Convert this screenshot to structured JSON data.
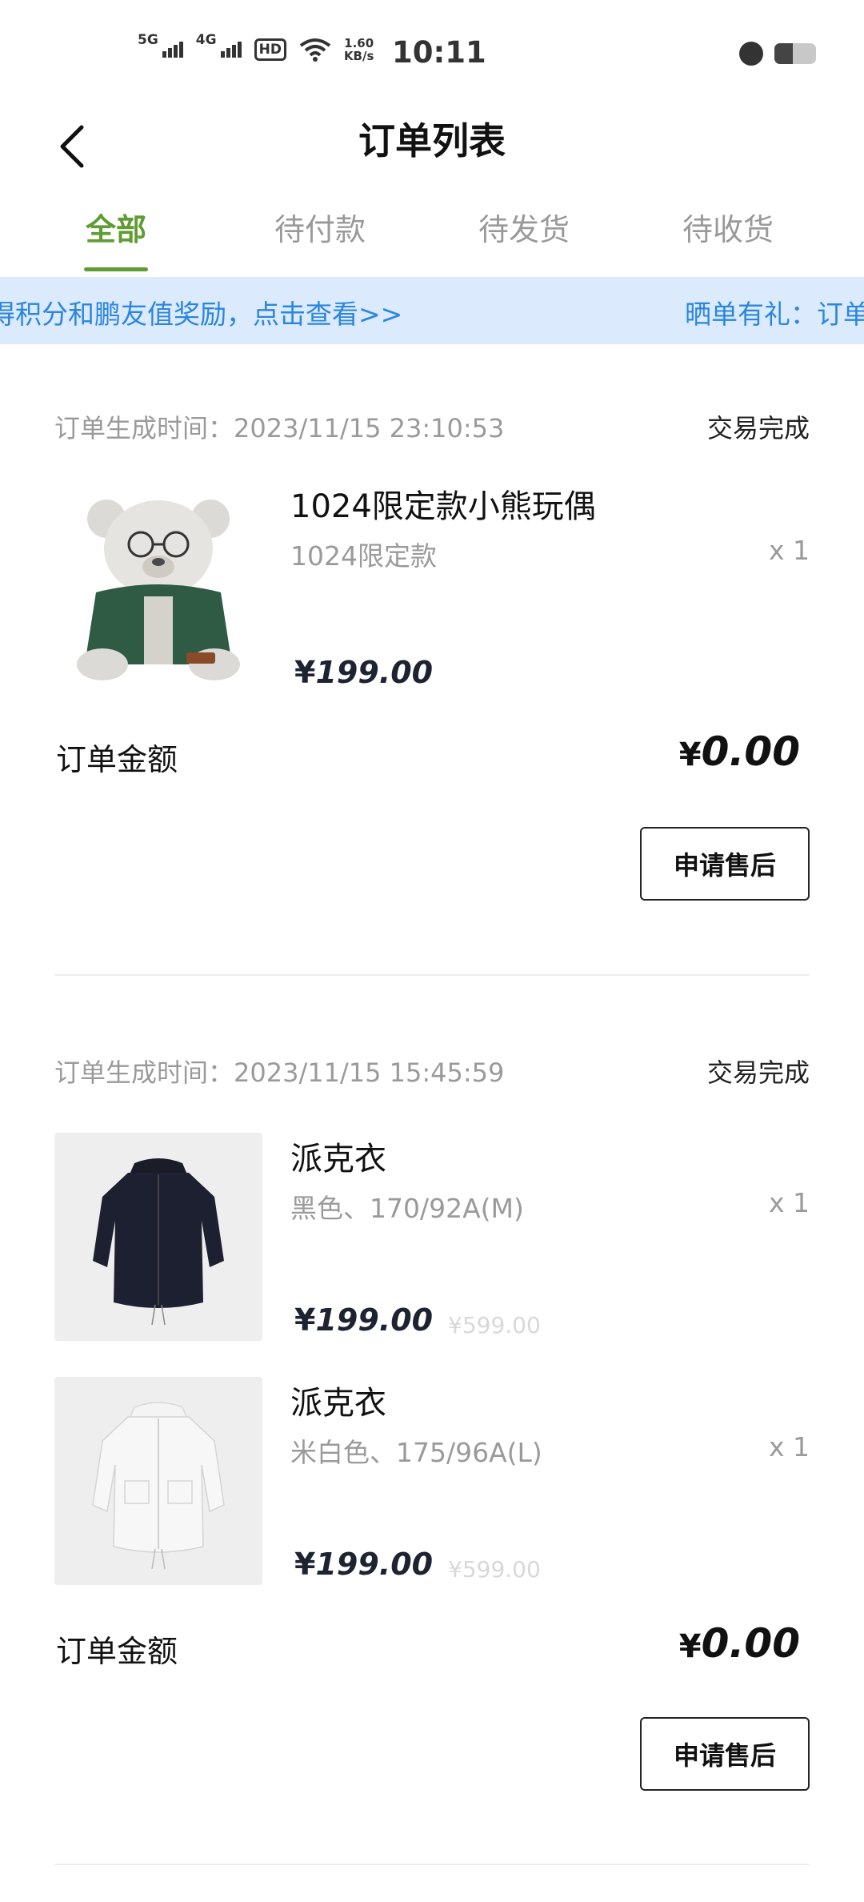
{
  "status_bar": {
    "sim1": "5G",
    "sim2": "4G",
    "hd": "HD",
    "speed_value": "1.60",
    "speed_unit": "KB/s",
    "time": "10:11",
    "battery_level": 0.45
  },
  "header": {
    "title": "订单列表",
    "back_icon": "chevron-left-icon"
  },
  "tabs": [
    {
      "label": "全部",
      "active": true
    },
    {
      "label": "待付款",
      "active": false
    },
    {
      "label": "待发货",
      "active": false
    },
    {
      "label": "待收货",
      "active": false
    }
  ],
  "banner": {
    "text_left": "得积分和鹏友值奖励，点击查看>>",
    "text_right": "晒单有礼：订单"
  },
  "orders": [
    {
      "time": "订单生成时间：2023/11/15 23:10:53",
      "status": "交易完成",
      "items": [
        {
          "name": "1024限定款小熊玩偶",
          "spec": "1024限定款",
          "qty": "x 1",
          "currency": "¥",
          "price": "199.00",
          "original_price": ""
        }
      ],
      "amount_label": "订单金额",
      "amount_currency": "¥",
      "amount": "0.00",
      "button": "申请售后"
    },
    {
      "time": "订单生成时间：2023/11/15 15:45:59",
      "status": "交易完成",
      "items": [
        {
          "name": "派克衣",
          "spec": "黑色、170/92A(M)",
          "qty": "x 1",
          "currency": "¥",
          "price": "199.00",
          "original_price": "¥599.00"
        },
        {
          "name": "派克衣",
          "spec": "米白色、175/96A(L)",
          "qty": "x 1",
          "currency": "¥",
          "price": "199.00",
          "original_price": "¥599.00"
        }
      ],
      "amount_label": "订单金额",
      "amount_currency": "¥",
      "amount": "0.00",
      "button": "申请售后"
    }
  ]
}
